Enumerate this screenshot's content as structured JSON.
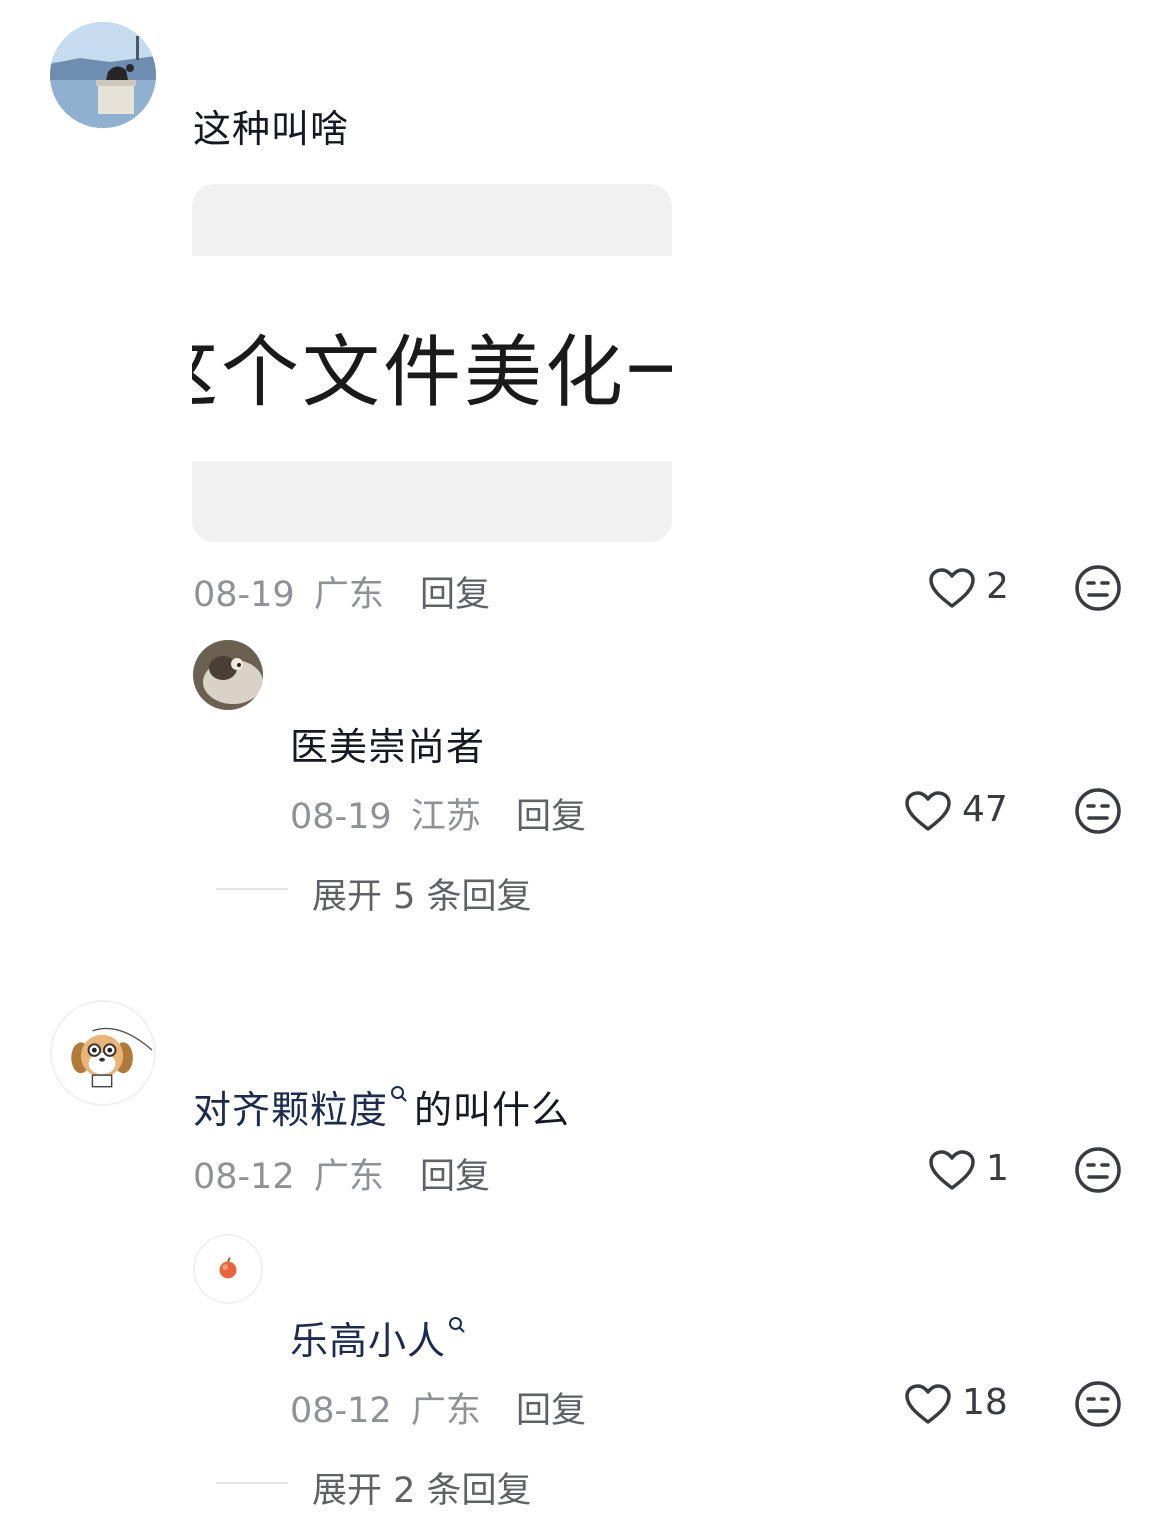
{
  "comments": [
    {
      "text": "这种叫啥",
      "image_text": "这个文件美化一",
      "date": "08-19",
      "location": "广东",
      "reply_label": "回复",
      "likes": "2",
      "reply": {
        "text": "医美崇尚者",
        "date": "08-19",
        "location": "江苏",
        "reply_label": "回复",
        "likes": "47"
      },
      "expand_label": "展开 5 条回复"
    },
    {
      "text_link": "对齐颗粒度",
      "text_rest": "的叫什么",
      "date": "08-12",
      "location": "广东",
      "reply_label": "回复",
      "likes": "1",
      "reply": {
        "text": "乐高小人",
        "date": "08-12",
        "location": "广东",
        "reply_label": "回复",
        "likes": "18"
      },
      "expand_label": "展开 2 条回复"
    }
  ],
  "icons": {
    "like": "heart-outline-icon",
    "dislike": "meh-face-icon",
    "search": "search-icon"
  },
  "colors": {
    "text": "#161823",
    "meta": "#8f9196",
    "link": "#1d2b4f",
    "icon": "#3a3b40"
  }
}
